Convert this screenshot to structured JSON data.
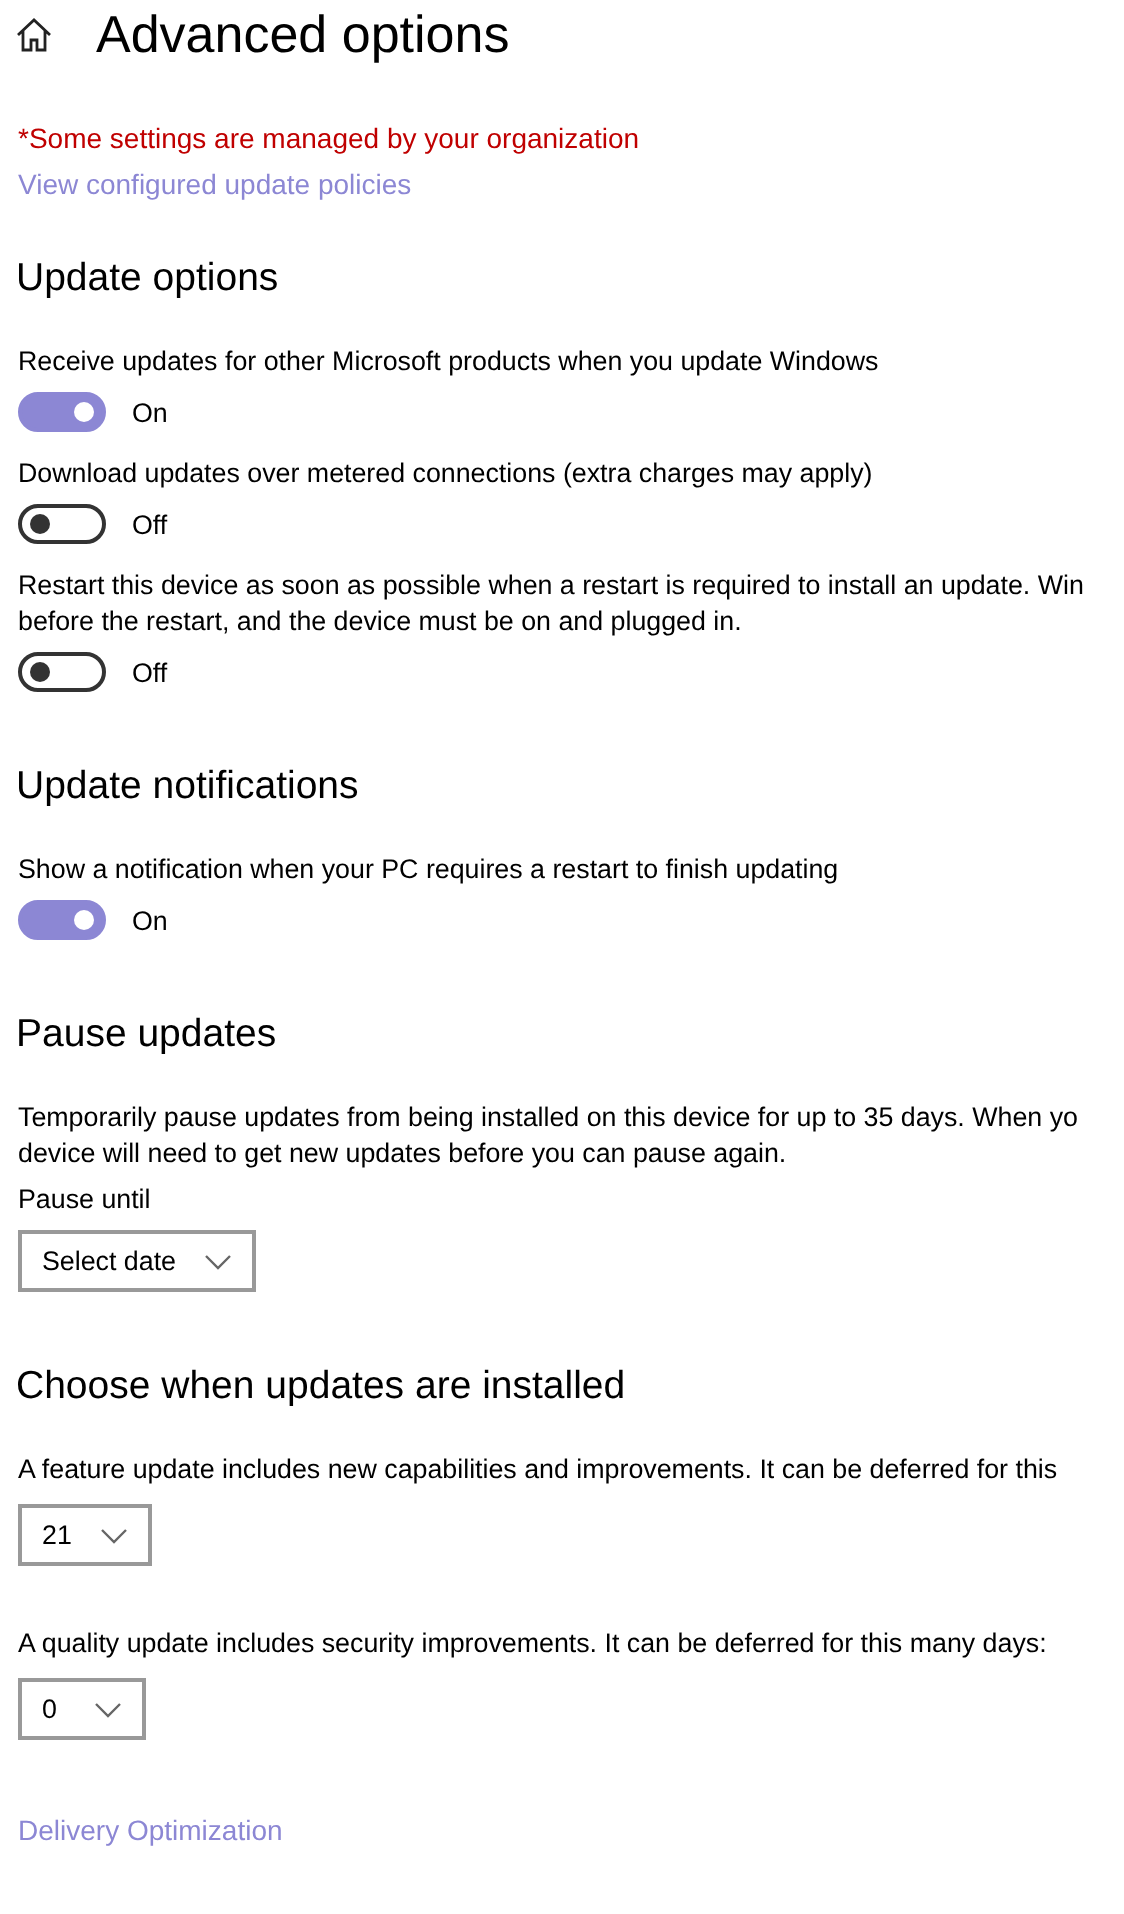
{
  "header": {
    "title": "Advanced options"
  },
  "notice": {
    "text": "*Some settings are managed by your organization",
    "link": "View configured update policies"
  },
  "sections": [
    {
      "heading": "Update options",
      "items": [
        {
          "kind": "toggle",
          "label": [
            "Receive updates for other Microsoft products when you update Windows"
          ],
          "on": true,
          "state_text": "On"
        },
        {
          "kind": "toggle",
          "label": [
            "Download updates over metered connections (extra charges may apply)"
          ],
          "on": false,
          "state_text": "Off"
        },
        {
          "kind": "toggle",
          "label": [
            "Restart this device as soon as possible when a restart is required to install an update. Win",
            "before the restart, and the device must be on and plugged in."
          ],
          "on": false,
          "state_text": "Off"
        }
      ]
    },
    {
      "heading": "Update notifications",
      "items": [
        {
          "kind": "toggle",
          "label": [
            "Show a notification when your PC requires a restart to finish updating"
          ],
          "on": true,
          "state_text": "On"
        }
      ]
    },
    {
      "heading": "Pause updates",
      "items": [
        {
          "kind": "select",
          "label": [
            "Temporarily pause updates from being installed on this device for up to 35 days. When yo",
            "device will need to get new updates before you can pause again."
          ],
          "caption": "Pause until",
          "value": "Select date"
        }
      ]
    },
    {
      "heading": "Choose when updates are installed",
      "items": [
        {
          "kind": "select",
          "label": [
            "A feature update includes new capabilities and improvements. It can be deferred for this"
          ],
          "value": "21"
        },
        {
          "kind": "select",
          "label": [
            "A quality update includes security improvements. It can be deferred for this many days:"
          ],
          "value": "0"
        }
      ]
    }
  ],
  "footer_link": "Delivery Optimization"
}
